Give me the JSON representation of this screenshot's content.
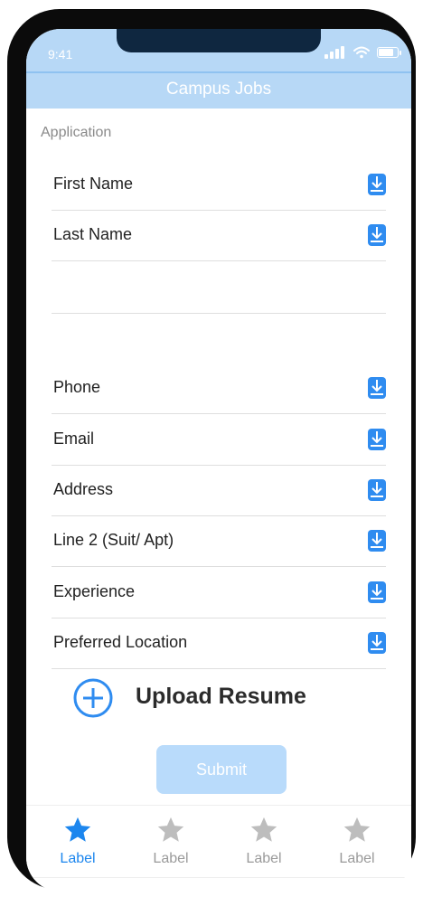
{
  "status_bar": {
    "time": "9:41"
  },
  "header": {
    "title": "Campus Jobs"
  },
  "form": {
    "section_label": "Application",
    "fields": [
      {
        "label": "First Name"
      },
      {
        "label": "Last Name"
      },
      {
        "label": "Phone"
      },
      {
        "label": "Email"
      },
      {
        "label": "Address"
      },
      {
        "label": "Line 2 (Suit/ Apt)"
      },
      {
        "label": "Experience"
      },
      {
        "label": "Preferred Location"
      }
    ],
    "upload_label": "Upload Resume",
    "submit_label": "Submit"
  },
  "tabbar": {
    "tabs": [
      {
        "label": "Label",
        "active": true
      },
      {
        "label": "Label",
        "active": false
      },
      {
        "label": "Label",
        "active": false
      },
      {
        "label": "Label",
        "active": false
      }
    ]
  },
  "colors": {
    "accent": "#2f8cf0",
    "header_bg": "#b7d8f6",
    "submit_bg": "#b9dbfb",
    "tab_active": "#1c86ee",
    "tab_inactive": "#bdbdbd"
  },
  "icons": {
    "field_action": "download-icon",
    "upload": "plus-circle-icon",
    "tab": "star-icon"
  }
}
